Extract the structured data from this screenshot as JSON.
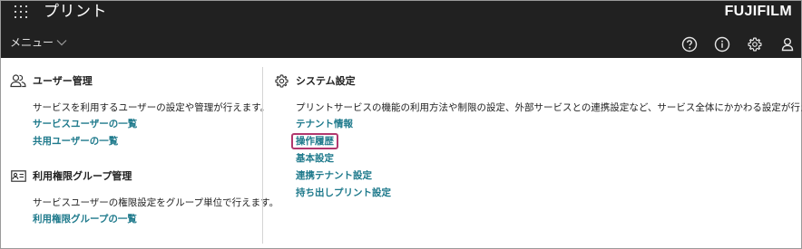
{
  "header": {
    "app_title": "プリント",
    "brand": "FUJIFILM",
    "menu_label": "メニュー",
    "icons": [
      "help-icon",
      "info-icon",
      "gear-icon",
      "user-icon"
    ]
  },
  "left": {
    "user_admin": {
      "title": "ユーザー管理",
      "description": "サービスを利用するユーザーの設定や管理が行えます。",
      "links": [
        "サービスユーザーの一覧",
        "共用ユーザーの一覧"
      ]
    },
    "permission_group": {
      "title": "利用権限グループ管理",
      "description": "サービスユーザーの権限設定をグループ単位で行えます。",
      "links": [
        "利用権限グループの一覧"
      ]
    }
  },
  "right": {
    "system_settings": {
      "title": "システム設定",
      "description": "プリントサービスの機能の利用方法や制限の設定、外部サービスとの連携設定など、サービス全体にかかわる設定が行えます。",
      "links": [
        "テナント情報",
        "操作履歴",
        "基本設定",
        "連携テナント設定",
        "持ち出しプリント設定"
      ]
    }
  },
  "colors": {
    "topbar": "#212121",
    "link": "#1f7a8c",
    "highlight": "#b2386e"
  }
}
